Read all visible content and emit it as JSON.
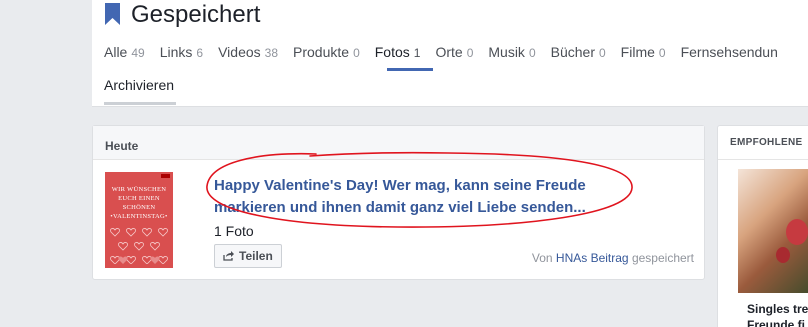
{
  "header": {
    "title": "Gespeichert",
    "tabs": [
      {
        "label": "Alle",
        "count": "49"
      },
      {
        "label": "Links",
        "count": "6"
      },
      {
        "label": "Videos",
        "count": "38"
      },
      {
        "label": "Produkte",
        "count": "0"
      },
      {
        "label": "Fotos",
        "count": "1"
      },
      {
        "label": "Orte",
        "count": "0"
      },
      {
        "label": "Musik",
        "count": "0"
      },
      {
        "label": "Bücher",
        "count": "0"
      },
      {
        "label": "Filme",
        "count": "0"
      },
      {
        "label": "Fernsehsendun",
        "count": ""
      }
    ],
    "active_tab": "Fotos",
    "archive_label": "Archivieren"
  },
  "card": {
    "section_label": "Heute",
    "thumb_text_lines": [
      "WIR WÜNSCHEN",
      "EUCH EINEN",
      "SCHÖNEN",
      "•VALENTINSTAG•"
    ],
    "post_title": "Happy Valentine's Day! Wer mag, kann seine Freude markieren und ihnen damit ganz viel Liebe senden...",
    "post_sub": "1 Foto",
    "share_label": "Teilen",
    "saved_prefix": "Von",
    "saved_link": "HNAs Beitrag",
    "saved_suffix": "gespeichert"
  },
  "right_panel": {
    "header": "EMPFOHLENE",
    "caption_line1": "Singles tre",
    "caption_line2": "Freunde fi"
  },
  "colors": {
    "accent": "#4267b2",
    "link": "#365899",
    "annotation": "#e0141e",
    "thumb_bg": "#d94f4f"
  }
}
